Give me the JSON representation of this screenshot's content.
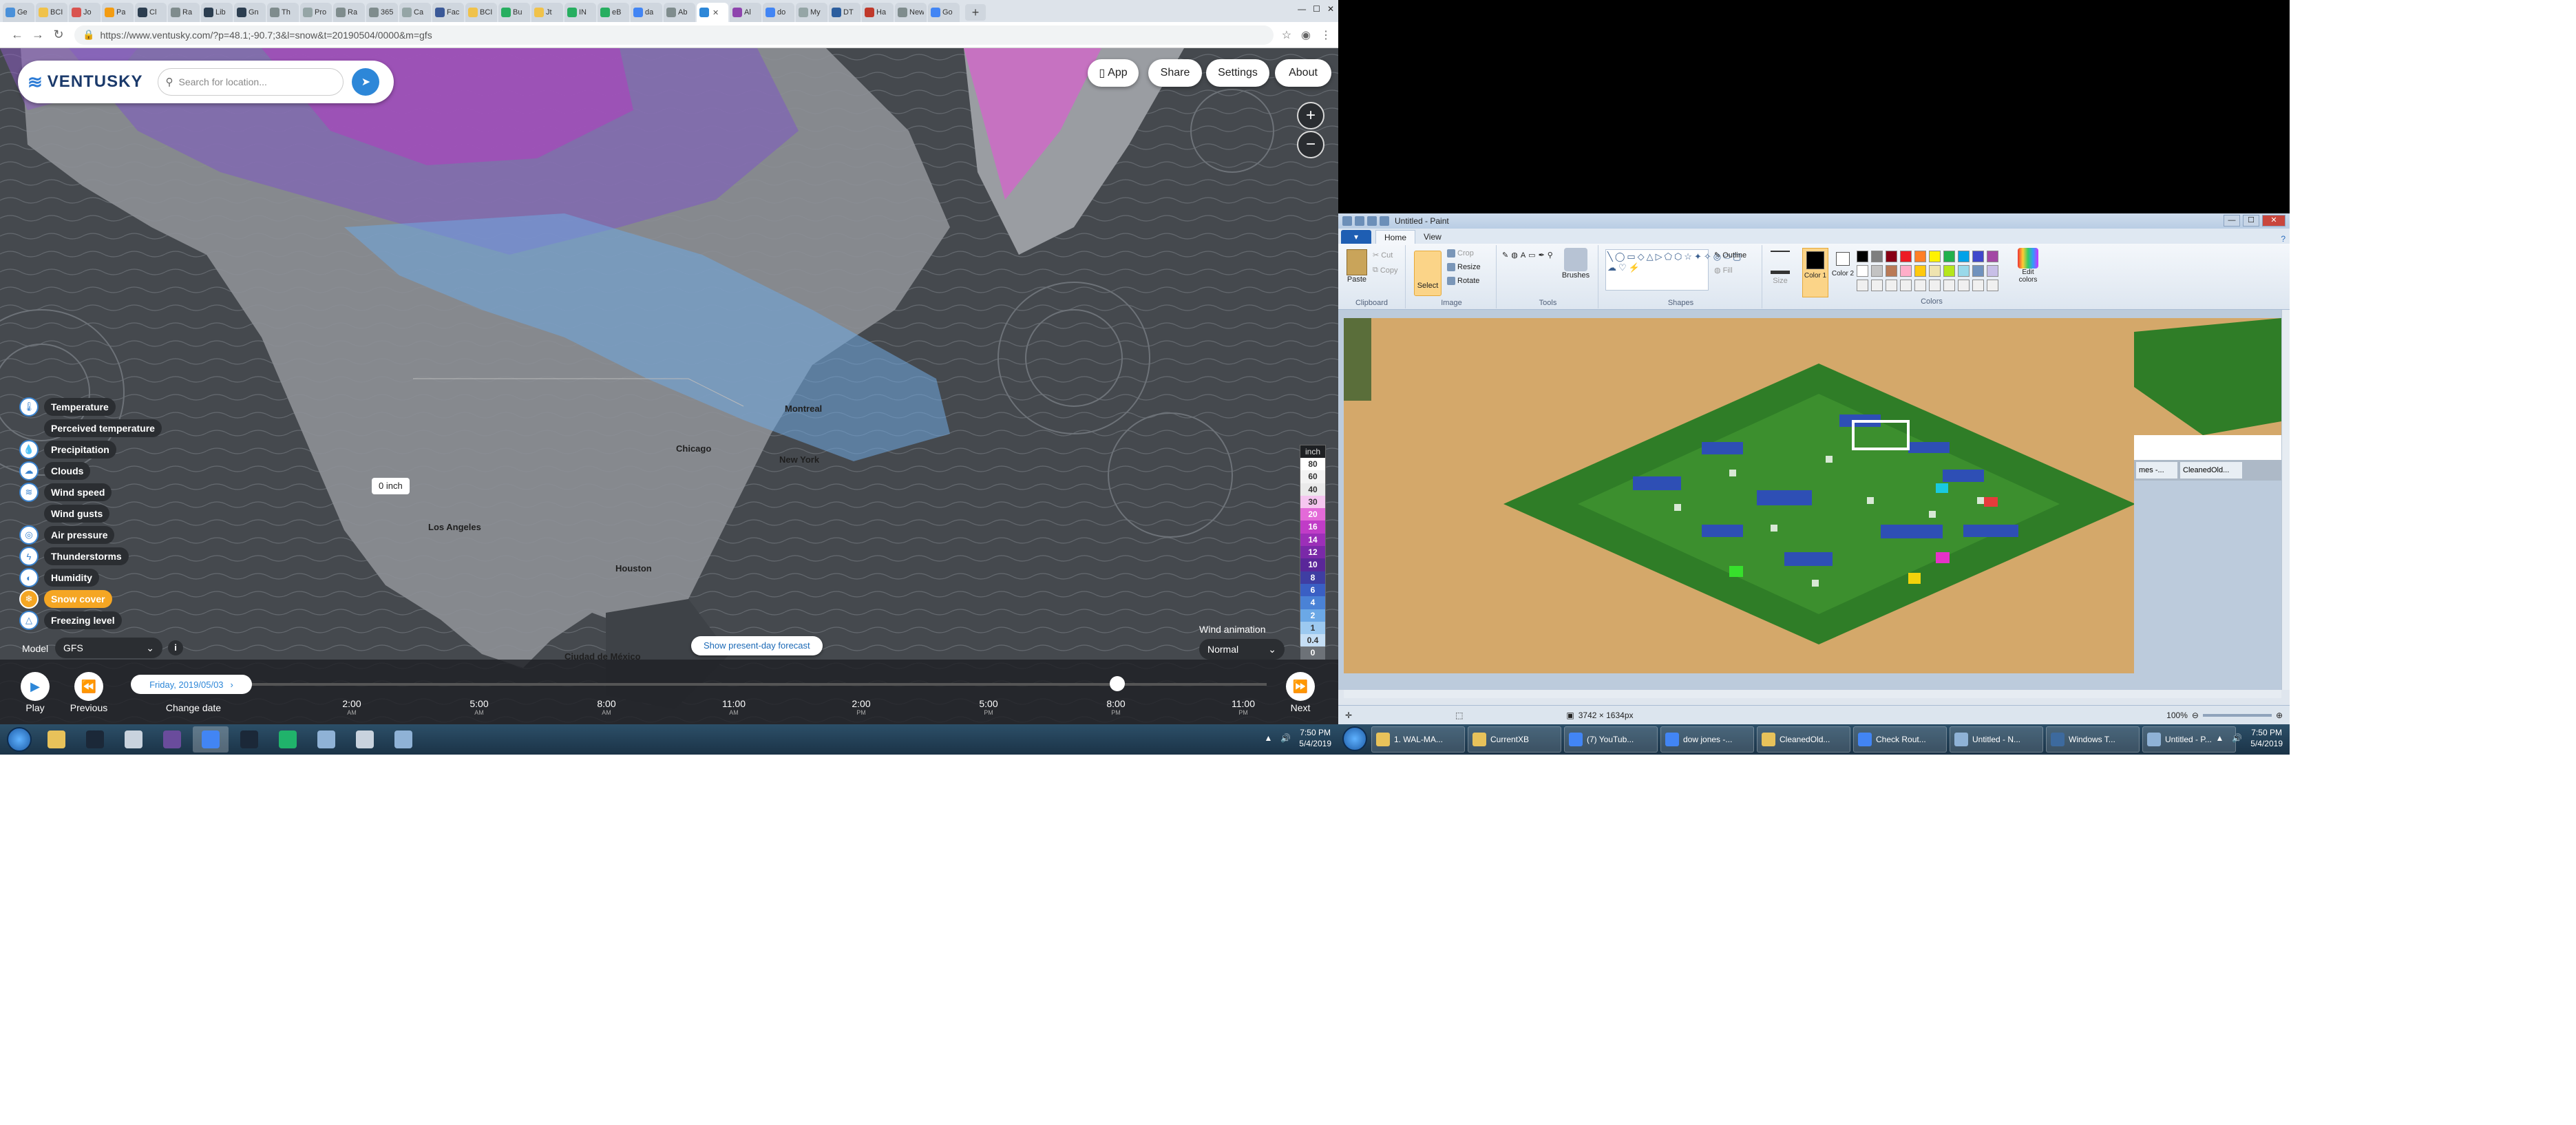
{
  "chrome": {
    "tabs": [
      {
        "label": "Ge",
        "color": "#4a90d9"
      },
      {
        "label": "BCI",
        "color": "#f0c24a"
      },
      {
        "label": "Jo",
        "color": "#d9534f"
      },
      {
        "label": "Pa",
        "color": "#f39c12"
      },
      {
        "label": "Cl",
        "color": "#2c3e50"
      },
      {
        "label": "Ra",
        "color": "#7f8c8d"
      },
      {
        "label": "Lib",
        "color": "#2c3e50"
      },
      {
        "label": "Gn",
        "color": "#2c3e50"
      },
      {
        "label": "Th",
        "color": "#7f8c8d"
      },
      {
        "label": "Pro",
        "color": "#95a5a6"
      },
      {
        "label": "Ra",
        "color": "#7f8c8d"
      },
      {
        "label": "365",
        "color": "#7f8c8d"
      },
      {
        "label": "Ca",
        "color": "#95a5a6"
      },
      {
        "label": "Fac",
        "color": "#3b5998"
      },
      {
        "label": "BCI",
        "color": "#f0c24a"
      },
      {
        "label": "Bu",
        "color": "#27ae60"
      },
      {
        "label": "Jt",
        "color": "#f0c24a"
      },
      {
        "label": "IN",
        "color": "#27ae60"
      },
      {
        "label": "eB",
        "color": "#27ae60"
      },
      {
        "label": "da",
        "color": "#4285f4"
      },
      {
        "label": "Ab",
        "color": "#7f8c8d"
      },
      {
        "label": "",
        "color": "#2d87d8",
        "active": true
      },
      {
        "label": "Al",
        "color": "#8e44ad"
      },
      {
        "label": "do",
        "color": "#4285f4"
      },
      {
        "label": "My",
        "color": "#95a5a6"
      },
      {
        "label": "DT",
        "color": "#2c5e9e"
      },
      {
        "label": "Ha",
        "color": "#c0392b"
      },
      {
        "label": "New Ta",
        "color": "#7f8c8d"
      },
      {
        "label": "Go",
        "color": "#4285f4"
      }
    ],
    "new_tab": "+",
    "url": "https://www.ventusky.com/?p=48.1;-90.7;3&l=snow&t=20190504/0000&m=gfs"
  },
  "ventusky": {
    "logo": "VENTUSKY",
    "search_placeholder": "Search for location...",
    "top_buttons": {
      "app": "App",
      "share": "Share",
      "settings": "Settings",
      "about": "About"
    },
    "zoom_in": "+",
    "zoom_out": "−",
    "layers": [
      {
        "label": "Temperature",
        "icon": "thermometer-icon",
        "glyph": "🌡"
      },
      {
        "label": "Perceived temperature",
        "icon": "",
        "glyph": ""
      },
      {
        "label": "Precipitation",
        "icon": "raindrop-icon",
        "glyph": "💧"
      },
      {
        "label": "Clouds",
        "icon": "cloud-icon",
        "glyph": "☁"
      },
      {
        "label": "Wind speed",
        "icon": "wind-icon",
        "glyph": "≋"
      },
      {
        "label": "Wind gusts",
        "icon": "",
        "glyph": ""
      },
      {
        "label": "Air pressure",
        "icon": "pressure-icon",
        "glyph": "◎"
      },
      {
        "label": "Thunderstorms",
        "icon": "lightning-icon",
        "glyph": "ϟ"
      },
      {
        "label": "Humidity",
        "icon": "humidity-icon",
        "glyph": "◐"
      },
      {
        "label": "Snow cover",
        "icon": "snowflake-icon",
        "glyph": "❄",
        "active": true
      },
      {
        "label": "Freezing level",
        "icon": "freezing-icon",
        "glyph": "△"
      }
    ],
    "legend": {
      "unit": "inch",
      "levels": [
        {
          "v": "80",
          "c": "#ffffff",
          "t": "#333"
        },
        {
          "v": "60",
          "c": "#f3f3f3",
          "t": "#333"
        },
        {
          "v": "40",
          "c": "#eaeaea",
          "t": "#333"
        },
        {
          "v": "30",
          "c": "#f5c6f0",
          "t": "#333"
        },
        {
          "v": "20",
          "c": "#e36ad8",
          "t": "#fff"
        },
        {
          "v": "16",
          "c": "#c03cc7",
          "t": "#fff"
        },
        {
          "v": "14",
          "c": "#9c2fb8",
          "t": "#fff"
        },
        {
          "v": "12",
          "c": "#7a29a8",
          "t": "#fff"
        },
        {
          "v": "10",
          "c": "#5a2799",
          "t": "#fff"
        },
        {
          "v": "8",
          "c": "#3f3ea3",
          "t": "#fff"
        },
        {
          "v": "6",
          "c": "#3a5fc4",
          "t": "#fff"
        },
        {
          "v": "4",
          "c": "#4a82d6",
          "t": "#fff"
        },
        {
          "v": "2",
          "c": "#6ba8e6",
          "t": "#fff"
        },
        {
          "v": "1",
          "c": "#9cc9f0",
          "t": "#333"
        },
        {
          "v": "0.4",
          "c": "#c5def5",
          "t": "#333"
        },
        {
          "v": "0",
          "c": "#6d7278",
          "t": "#fff"
        }
      ]
    },
    "map_label": "0 inch",
    "cities": [
      "Montreal",
      "Chicago",
      "New York",
      "Los Angeles",
      "Houston",
      "Ciudad de México"
    ],
    "present_forecast": "Show present-day forecast",
    "wind_animation": {
      "label": "Wind animation",
      "value": "Normal"
    },
    "model": {
      "label": "Model",
      "value": "GFS"
    },
    "timeline": {
      "hours": [
        {
          "t": "2:00",
          "ap": "AM"
        },
        {
          "t": "5:00",
          "ap": "AM"
        },
        {
          "t": "8:00",
          "ap": "AM"
        },
        {
          "t": "11:00",
          "ap": "AM"
        },
        {
          "t": "2:00",
          "ap": "PM"
        },
        {
          "t": "5:00",
          "ap": "PM"
        },
        {
          "t": "8:00",
          "ap": "PM"
        },
        {
          "t": "11:00",
          "ap": "PM"
        }
      ],
      "date": "Friday, 2019/05/03",
      "play": "Play",
      "previous": "Previous",
      "change_date": "Change date",
      "next": "Next"
    }
  },
  "taskbar_left": {
    "icons": [
      "folder-icon",
      "steam-icon",
      "app-icon",
      "app-icon",
      "chrome-icon",
      "steam-icon",
      "pycharm-icon",
      "paint-icon",
      "app-icon",
      "notepad-icon"
    ],
    "time": "7:50 PM",
    "date": "5/4/2019"
  },
  "paint": {
    "title": "Untitled - Paint",
    "tabs": {
      "file": "▾",
      "home": "Home",
      "view": "View"
    },
    "groups": {
      "clipboard": "Clipboard",
      "image": "Image",
      "tools": "Tools",
      "shapes": "Shapes",
      "colors": "Colors"
    },
    "buttons": {
      "paste": "Paste",
      "cut": "Cut",
      "copy": "Copy",
      "select": "Select",
      "crop": "Crop",
      "resize": "Resize",
      "rotate": "Rotate",
      "brushes": "Brushes",
      "outline": "Outline",
      "fill": "Fill",
      "size": "Size",
      "color1": "Color 1",
      "color2": "Color 2",
      "edit_colors": "Edit colors"
    },
    "palette": [
      "#000000",
      "#7f7f7f",
      "#880015",
      "#ed1c24",
      "#ff7f27",
      "#fff200",
      "#22b14c",
      "#00a2e8",
      "#3f48cc",
      "#a349a4",
      "#ffffff",
      "#c3c3c3",
      "#b97a57",
      "#ffaec9",
      "#ffc90e",
      "#efe4b0",
      "#b5e61d",
      "#99d9ea",
      "#7092be",
      "#c8bfe7",
      "#f0f0f0",
      "#f0f0f0",
      "#f0f0f0",
      "#f0f0f0",
      "#f0f0f0",
      "#f0f0f0",
      "#f0f0f0",
      "#f0f0f0",
      "#f0f0f0",
      "#f0f0f0"
    ],
    "color1": "#000000",
    "color2": "#ffffff",
    "status_size": "3742 × 1634px",
    "zoom": "100%",
    "thumbs": [
      "mes -...",
      "CleanedOld..."
    ]
  },
  "taskbar_right": {
    "tasks": [
      {
        "label": "1. WAL-MA...",
        "color": "#e8c25a"
      },
      {
        "label": "CurrentXB",
        "color": "#e8c25a"
      },
      {
        "label": "(7) YouTub...",
        "color": "#4285f4"
      },
      {
        "label": "dow jones -...",
        "color": "#4285f4"
      },
      {
        "label": "CleanedOld...",
        "color": "#e8c25a"
      },
      {
        "label": "Check Rout...",
        "color": "#4285f4"
      },
      {
        "label": "Untitled - N...",
        "color": "#8fb2d6"
      },
      {
        "label": "Windows T...",
        "color": "#3d6a9e"
      },
      {
        "label": "Untitled - P...",
        "color": "#8fb2d6"
      }
    ],
    "time": "7:50 PM",
    "date": "5/4/2019"
  }
}
